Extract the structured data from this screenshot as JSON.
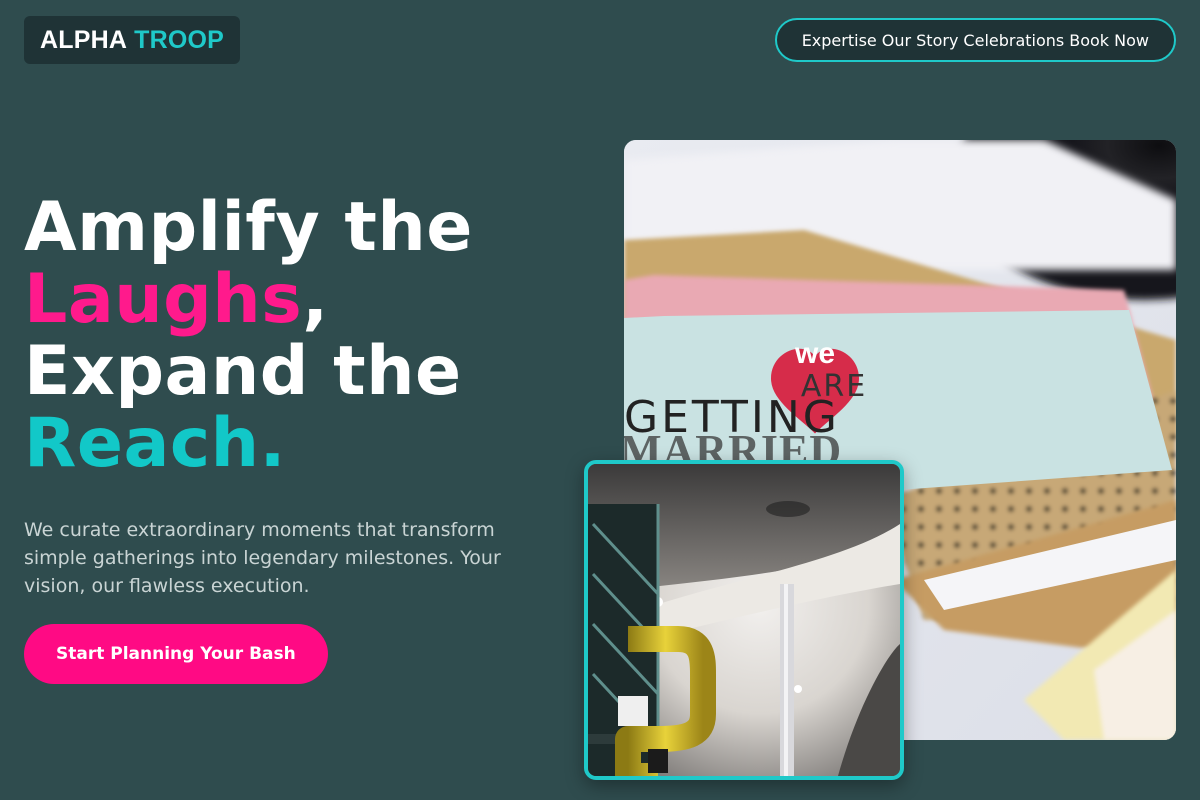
{
  "brand": {
    "word1": "ALPHA",
    "word2": "TROOP",
    "colors": {
      "white": "#ffffff",
      "teal": "#1fc9c9"
    }
  },
  "nav": {
    "items": [
      {
        "label": "Expertise"
      },
      {
        "label": "Our Story"
      },
      {
        "label": "Celebrations"
      },
      {
        "label": "Book Now"
      }
    ]
  },
  "hero": {
    "line1": "Amplify the",
    "laughs": "Laughs",
    "comma": ",",
    "line3": "Expand the",
    "reach": "Reach.",
    "lead": "We curate extraordinary moments that transform simple gatherings into legendary milestones. Your vision, our flawless execution.",
    "cta": "Start Planning Your Bash"
  },
  "media": {
    "main_card": {
      "we": "we",
      "are": "ARE",
      "getting": "GETTING",
      "married": "MARRIED"
    }
  },
  "theme": {
    "background": "#2f4c4e",
    "accent_pink": "#ff1a8c",
    "accent_teal": "#12c8c8"
  }
}
